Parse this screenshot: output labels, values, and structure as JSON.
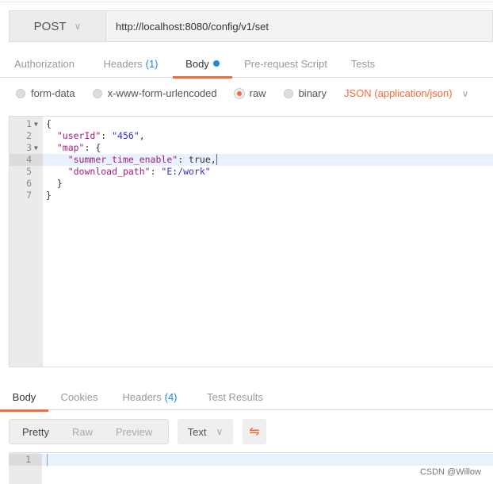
{
  "request": {
    "method": "POST",
    "url": "http://localhost:8080/config/v1/set"
  },
  "tabs": [
    {
      "label": "Authorization"
    },
    {
      "label": "Headers",
      "count": "(1)"
    },
    {
      "label": "Body"
    },
    {
      "label": "Pre-request Script"
    },
    {
      "label": "Tests"
    }
  ],
  "body_modes": [
    {
      "label": "form-data",
      "selected": false
    },
    {
      "label": "x-www-form-urlencoded",
      "selected": false
    },
    {
      "label": "raw",
      "selected": true
    },
    {
      "label": "binary",
      "selected": false
    }
  ],
  "content_type": "JSON (application/json)",
  "editor_lines": [
    "1",
    "2",
    "3",
    "4",
    "5",
    "6",
    "7"
  ],
  "code": {
    "open": "{",
    "k_userId": "\"userId\"",
    "v_userId": "\"456\"",
    "k_map": "\"map\"",
    "k_summer": "\"summer_time_enable\"",
    "v_summer": "true",
    "k_download": "\"download_path\"",
    "v_download": "\"E:/work\"",
    "close_inner": "}",
    "close_outer": "}"
  },
  "response_tabs": [
    {
      "label": "Body"
    },
    {
      "label": "Cookies"
    },
    {
      "label": "Headers",
      "count": "(4)"
    },
    {
      "label": "Test Results"
    }
  ],
  "view_modes": [
    "Pretty",
    "Raw",
    "Preview"
  ],
  "format": "Text",
  "response_line": "1",
  "watermark": "CSDN @Willow",
  "colors": {
    "accent": "#f26b3a",
    "count": "#1e88e5",
    "key": "#a21d7e",
    "string": "#2d2ddd"
  }
}
